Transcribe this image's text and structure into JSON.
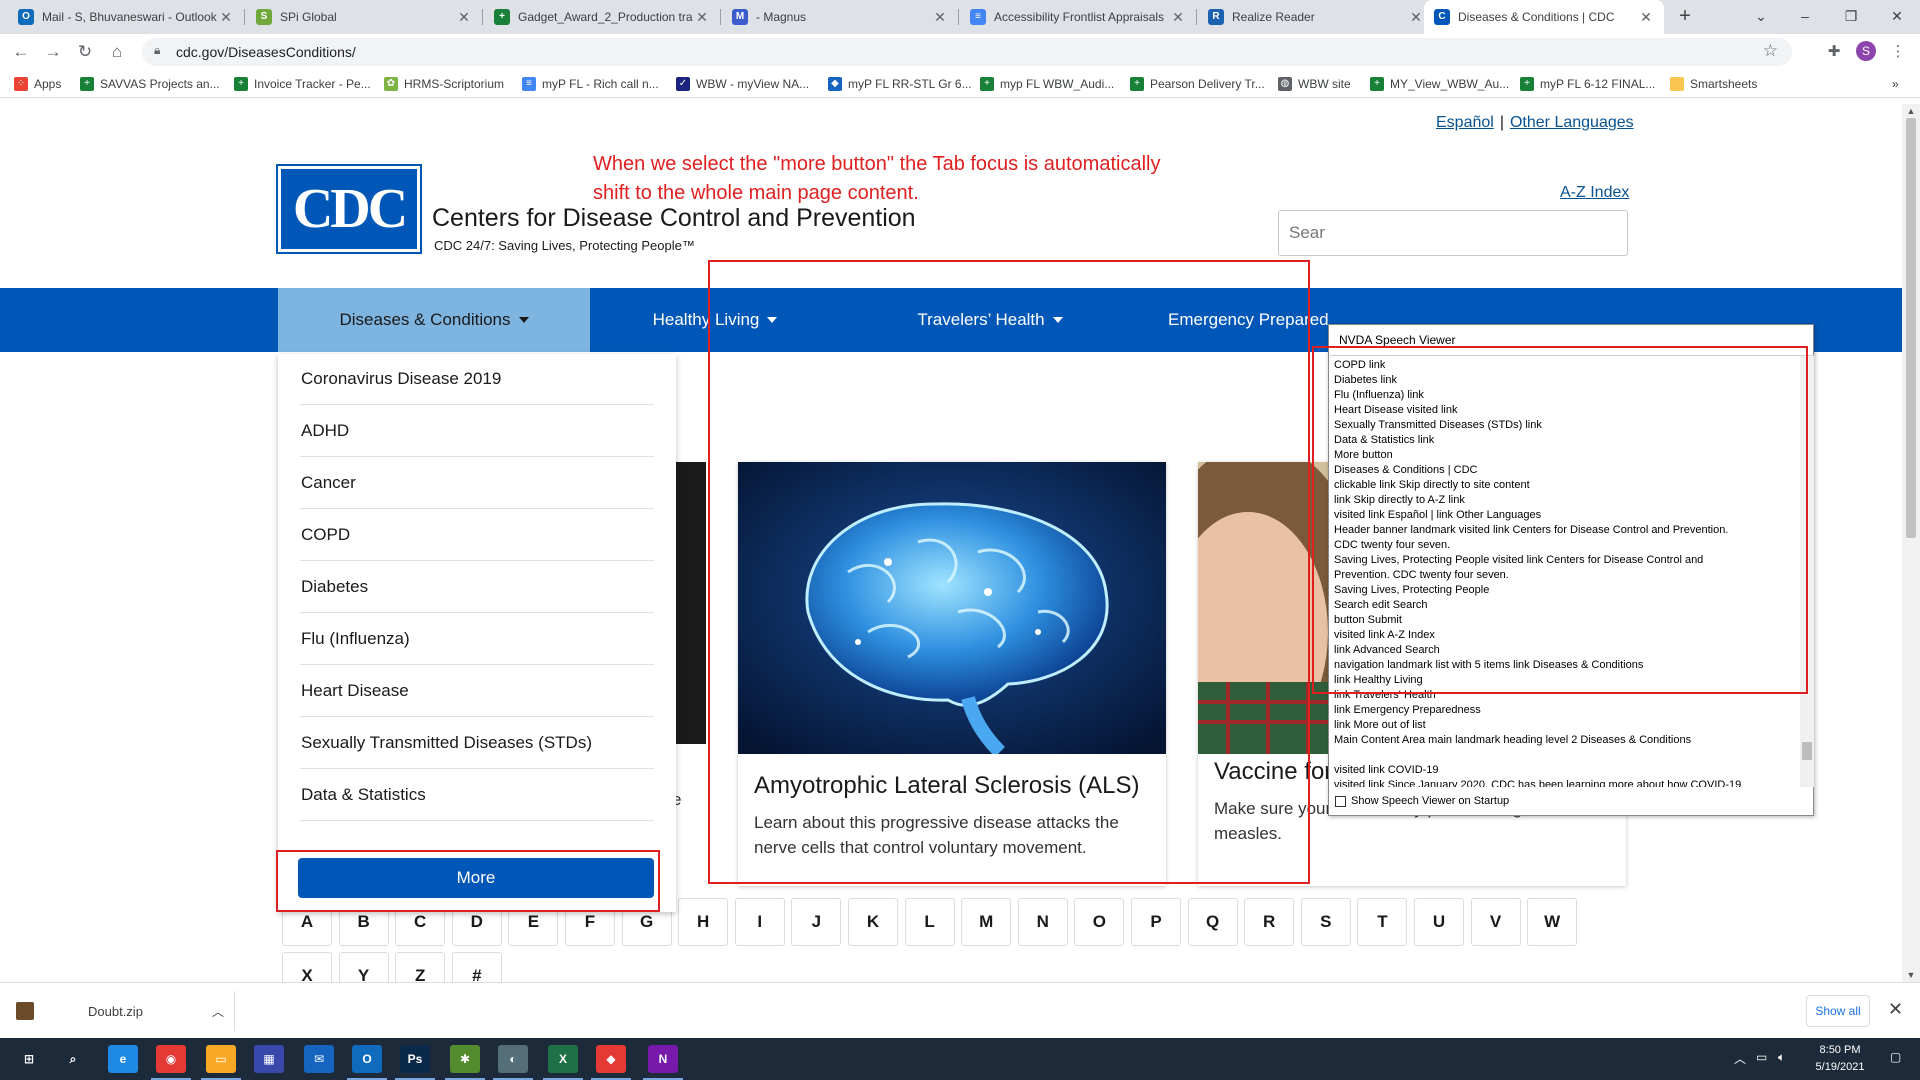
{
  "tabs": [
    {
      "label": "Mail - S, Bhuvaneswari - Outlook",
      "icon": "outlook-icon",
      "color": "#0f6cbd",
      "glyph": "O"
    },
    {
      "label": "SPi Global",
      "icon": "spi-global-icon",
      "color": "#70a83b",
      "glyph": "S"
    },
    {
      "label": "Gadget_Award_2_Production tra",
      "icon": "google-sheets-icon",
      "color": "#188038",
      "glyph": "+"
    },
    {
      "label": "- Magnus",
      "icon": "magnus-icon",
      "color": "#3b5ccc",
      "glyph": "M"
    },
    {
      "label": "Accessibility Frontlist Appraisals",
      "icon": "google-docs-icon",
      "color": "#4285f4",
      "glyph": "≡"
    },
    {
      "label": "Realize Reader",
      "icon": "realize-reader-icon",
      "color": "#1b62b3",
      "glyph": "R"
    },
    {
      "label": "Diseases & Conditions | CDC",
      "icon": "cdc-favicon-icon",
      "color": "#0057b7",
      "glyph": "C"
    }
  ],
  "address": {
    "url": "cdc.gov/DiseasesConditions/"
  },
  "bookmarks": [
    {
      "label": "Apps",
      "icon": "apps-grid-icon",
      "color": "#ea4335"
    },
    {
      "label": "SAVVAS Projects an...",
      "icon": "sheets-bookmark-icon",
      "color": "#188038"
    },
    {
      "label": "Invoice Tracker - Pe...",
      "icon": "sheets-bookmark-icon",
      "color": "#188038"
    },
    {
      "label": "HRMS-Scriptorium",
      "icon": "hrms-icon",
      "color": "#7cb342"
    },
    {
      "label": "myP FL - Rich call n...",
      "icon": "docs-bookmark-icon",
      "color": "#4285f4"
    },
    {
      "label": "WBW - myView NA...",
      "icon": "checkbox-bookmark-icon",
      "color": "#1a237e"
    },
    {
      "label": "myP FL RR-STL Gr 6...",
      "icon": "diamond-bookmark-icon",
      "color": "#1565c0"
    },
    {
      "label": "myp FL WBW_Audi...",
      "icon": "sheets-bookmark-icon",
      "color": "#188038"
    },
    {
      "label": "Pearson Delivery Tr...",
      "icon": "sheets-bookmark-icon",
      "color": "#188038"
    },
    {
      "label": "WBW site",
      "icon": "globe-bookmark-icon",
      "color": "#5f6368"
    },
    {
      "label": "MY_View_WBW_Au...",
      "icon": "sheets-bookmark-icon",
      "color": "#188038"
    },
    {
      "label": "myP FL 6-12 FINAL...",
      "icon": "sheets-bookmark-icon",
      "color": "#188038"
    },
    {
      "label": "Smartsheets",
      "icon": "folder-bookmark-icon",
      "color": "#f9c74f"
    }
  ],
  "site": {
    "lang_espanol": "Español",
    "lang_sep": "|",
    "lang_other": "Other Languages",
    "logo_text": "CDC",
    "title": "Centers for Disease Control and Prevention",
    "tagline": "CDC 24/7: Saving Lives, Protecting People™",
    "az_index": "A-Z Index",
    "search_placeholder": "Sear"
  },
  "annotation": {
    "line1": "When we select the \"more button\" the Tab focus is automatically",
    "line2": "shift to the whole main page content."
  },
  "nav": [
    {
      "label": "Diseases & Conditions",
      "active": true
    },
    {
      "label": "Healthy Living",
      "active": false
    },
    {
      "label": "Travelers’ Health",
      "active": false
    },
    {
      "label": "Emergency Prepared",
      "active": false
    }
  ],
  "dropdown": {
    "items": [
      "Coronavirus Disease 2019",
      "ADHD",
      "Cancer",
      "COPD",
      "Diabetes",
      "Flu (Influenza)",
      "Heart Disease",
      "Sexually Transmitted Diseases (STDs)",
      "Data & Statistics"
    ],
    "more_label": "More"
  },
  "cards": [
    {
      "title": "Amyotrophic Lateral Sclerosis (ALS)",
      "desc": "Learn about this progressive disease attacks the nerve cells that control voluntary movement."
    },
    {
      "title": "Vaccine for Measles",
      "desc": "Make sure your child is fully protected against measles."
    }
  ],
  "partial_e": "e",
  "letters_row1": [
    "A",
    "B",
    "C",
    "D",
    "E",
    "F",
    "G",
    "H",
    "I",
    "J",
    "K",
    "L",
    "M",
    "N",
    "O",
    "P",
    "Q",
    "R",
    "S",
    "T",
    "U",
    "V",
    "W"
  ],
  "letters_row2": [
    "X",
    "Y",
    "Z",
    "#"
  ],
  "nvda": {
    "title": "NVDA Speech Viewer",
    "lines": [
      "COPD  link",
      "Diabetes  link",
      "Flu (Influenza)  link",
      "Heart Disease  visited  link",
      "Sexually Transmitted Diseases (STDs)  link",
      "Data & Statistics  link",
      "More  button",
      "Diseases & Conditions | CDC",
      "clickable  link   Skip directly to site content",
      "link   Skip directly to A-Z link",
      "visited  link   Español   |   link   Other Languages",
      "Header  banner landmark   visited  link   Centers for Disease Control and Prevention.",
      "CDC twenty four seven.",
      "Saving Lives, Protecting People  visited  link    Centers for Disease Control and",
      "Prevention. CDC twenty four seven.",
      "Saving Lives, Protecting People",
      "Search  edit   Search",
      "button   Submit",
      "visited  link    A-Z Index",
      "link   Advanced Search",
      "navigation landmark   list  with 5 items  link    Diseases & Conditions",
      "link   Healthy Living",
      "link   Travelers' Health",
      "link   Emergency Preparedness",
      "link   More  out of list",
      "Main Content Area  main landmark    heading    level 2  Diseases & Conditions",
      "",
      "visited  link    COVID-19",
      "visited  link   Since January 2020, CDC has been learning more about how COVID-19"
    ],
    "footer": "Show Speech Viewer on Startup"
  },
  "download": {
    "file": "Doubt.zip",
    "show_all": "Show all"
  },
  "taskbar": {
    "apps": [
      {
        "icon": "windows-start-icon",
        "color": "#1d2a3a",
        "glyph": "⊞"
      },
      {
        "icon": "search-icon",
        "color": "#1d2a3a",
        "glyph": "⌕"
      },
      {
        "icon": "edge-icon",
        "color": "#1e88e5",
        "glyph": "e"
      },
      {
        "icon": "chrome-icon",
        "color": "#e53935",
        "glyph": "◉"
      },
      {
        "icon": "file-explorer-icon",
        "color": "#f9a825",
        "glyph": "▭"
      },
      {
        "icon": "store-icon",
        "color": "#3949ab",
        "glyph": "▦"
      },
      {
        "icon": "mail-icon",
        "color": "#1565c0",
        "glyph": "✉"
      },
      {
        "icon": "outlook-app-icon",
        "color": "#0f6cbd",
        "glyph": "O"
      },
      {
        "icon": "photoshop-icon",
        "color": "#0b2a4a",
        "glyph": "Ps"
      },
      {
        "icon": "puzzle-app-icon",
        "color": "#558b2f",
        "glyph": "✱"
      },
      {
        "icon": "nvda-app-icon",
        "color": "#546e7a",
        "glyph": "◐"
      },
      {
        "icon": "excel-icon",
        "color": "#1e7145",
        "glyph": "X"
      },
      {
        "icon": "anydesk-icon",
        "color": "#e53935",
        "glyph": "◆"
      },
      {
        "icon": "onenote-icon",
        "color": "#7719aa",
        "glyph": "N"
      }
    ],
    "time": "8:50 PM",
    "date": "5/19/2021"
  }
}
